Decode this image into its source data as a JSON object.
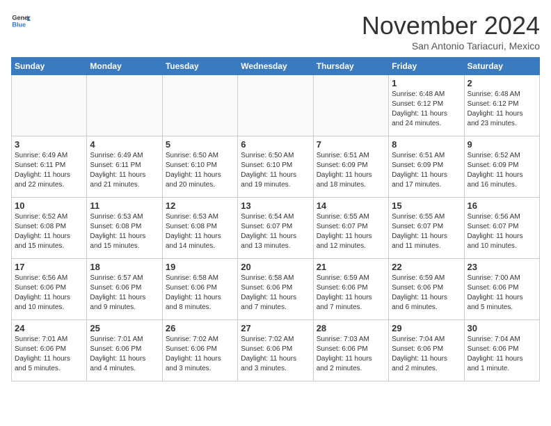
{
  "header": {
    "logo_general": "General",
    "logo_blue": "Blue",
    "month_title": "November 2024",
    "location": "San Antonio Tariacuri, Mexico"
  },
  "days_of_week": [
    "Sunday",
    "Monday",
    "Tuesday",
    "Wednesday",
    "Thursday",
    "Friday",
    "Saturday"
  ],
  "weeks": [
    [
      {
        "day": "",
        "info": ""
      },
      {
        "day": "",
        "info": ""
      },
      {
        "day": "",
        "info": ""
      },
      {
        "day": "",
        "info": ""
      },
      {
        "day": "",
        "info": ""
      },
      {
        "day": "1",
        "info": "Sunrise: 6:48 AM\nSunset: 6:12 PM\nDaylight: 11 hours\nand 24 minutes."
      },
      {
        "day": "2",
        "info": "Sunrise: 6:48 AM\nSunset: 6:12 PM\nDaylight: 11 hours\nand 23 minutes."
      }
    ],
    [
      {
        "day": "3",
        "info": "Sunrise: 6:49 AM\nSunset: 6:11 PM\nDaylight: 11 hours\nand 22 minutes."
      },
      {
        "day": "4",
        "info": "Sunrise: 6:49 AM\nSunset: 6:11 PM\nDaylight: 11 hours\nand 21 minutes."
      },
      {
        "day": "5",
        "info": "Sunrise: 6:50 AM\nSunset: 6:10 PM\nDaylight: 11 hours\nand 20 minutes."
      },
      {
        "day": "6",
        "info": "Sunrise: 6:50 AM\nSunset: 6:10 PM\nDaylight: 11 hours\nand 19 minutes."
      },
      {
        "day": "7",
        "info": "Sunrise: 6:51 AM\nSunset: 6:09 PM\nDaylight: 11 hours\nand 18 minutes."
      },
      {
        "day": "8",
        "info": "Sunrise: 6:51 AM\nSunset: 6:09 PM\nDaylight: 11 hours\nand 17 minutes."
      },
      {
        "day": "9",
        "info": "Sunrise: 6:52 AM\nSunset: 6:09 PM\nDaylight: 11 hours\nand 16 minutes."
      }
    ],
    [
      {
        "day": "10",
        "info": "Sunrise: 6:52 AM\nSunset: 6:08 PM\nDaylight: 11 hours\nand 15 minutes."
      },
      {
        "day": "11",
        "info": "Sunrise: 6:53 AM\nSunset: 6:08 PM\nDaylight: 11 hours\nand 15 minutes."
      },
      {
        "day": "12",
        "info": "Sunrise: 6:53 AM\nSunset: 6:08 PM\nDaylight: 11 hours\nand 14 minutes."
      },
      {
        "day": "13",
        "info": "Sunrise: 6:54 AM\nSunset: 6:07 PM\nDaylight: 11 hours\nand 13 minutes."
      },
      {
        "day": "14",
        "info": "Sunrise: 6:55 AM\nSunset: 6:07 PM\nDaylight: 11 hours\nand 12 minutes."
      },
      {
        "day": "15",
        "info": "Sunrise: 6:55 AM\nSunset: 6:07 PM\nDaylight: 11 hours\nand 11 minutes."
      },
      {
        "day": "16",
        "info": "Sunrise: 6:56 AM\nSunset: 6:07 PM\nDaylight: 11 hours\nand 10 minutes."
      }
    ],
    [
      {
        "day": "17",
        "info": "Sunrise: 6:56 AM\nSunset: 6:06 PM\nDaylight: 11 hours\nand 10 minutes."
      },
      {
        "day": "18",
        "info": "Sunrise: 6:57 AM\nSunset: 6:06 PM\nDaylight: 11 hours\nand 9 minutes."
      },
      {
        "day": "19",
        "info": "Sunrise: 6:58 AM\nSunset: 6:06 PM\nDaylight: 11 hours\nand 8 minutes."
      },
      {
        "day": "20",
        "info": "Sunrise: 6:58 AM\nSunset: 6:06 PM\nDaylight: 11 hours\nand 7 minutes."
      },
      {
        "day": "21",
        "info": "Sunrise: 6:59 AM\nSunset: 6:06 PM\nDaylight: 11 hours\nand 7 minutes."
      },
      {
        "day": "22",
        "info": "Sunrise: 6:59 AM\nSunset: 6:06 PM\nDaylight: 11 hours\nand 6 minutes."
      },
      {
        "day": "23",
        "info": "Sunrise: 7:00 AM\nSunset: 6:06 PM\nDaylight: 11 hours\nand 5 minutes."
      }
    ],
    [
      {
        "day": "24",
        "info": "Sunrise: 7:01 AM\nSunset: 6:06 PM\nDaylight: 11 hours\nand 5 minutes."
      },
      {
        "day": "25",
        "info": "Sunrise: 7:01 AM\nSunset: 6:06 PM\nDaylight: 11 hours\nand 4 minutes."
      },
      {
        "day": "26",
        "info": "Sunrise: 7:02 AM\nSunset: 6:06 PM\nDaylight: 11 hours\nand 3 minutes."
      },
      {
        "day": "27",
        "info": "Sunrise: 7:02 AM\nSunset: 6:06 PM\nDaylight: 11 hours\nand 3 minutes."
      },
      {
        "day": "28",
        "info": "Sunrise: 7:03 AM\nSunset: 6:06 PM\nDaylight: 11 hours\nand 2 minutes."
      },
      {
        "day": "29",
        "info": "Sunrise: 7:04 AM\nSunset: 6:06 PM\nDaylight: 11 hours\nand 2 minutes."
      },
      {
        "day": "30",
        "info": "Sunrise: 7:04 AM\nSunset: 6:06 PM\nDaylight: 11 hours\nand 1 minute."
      }
    ]
  ]
}
